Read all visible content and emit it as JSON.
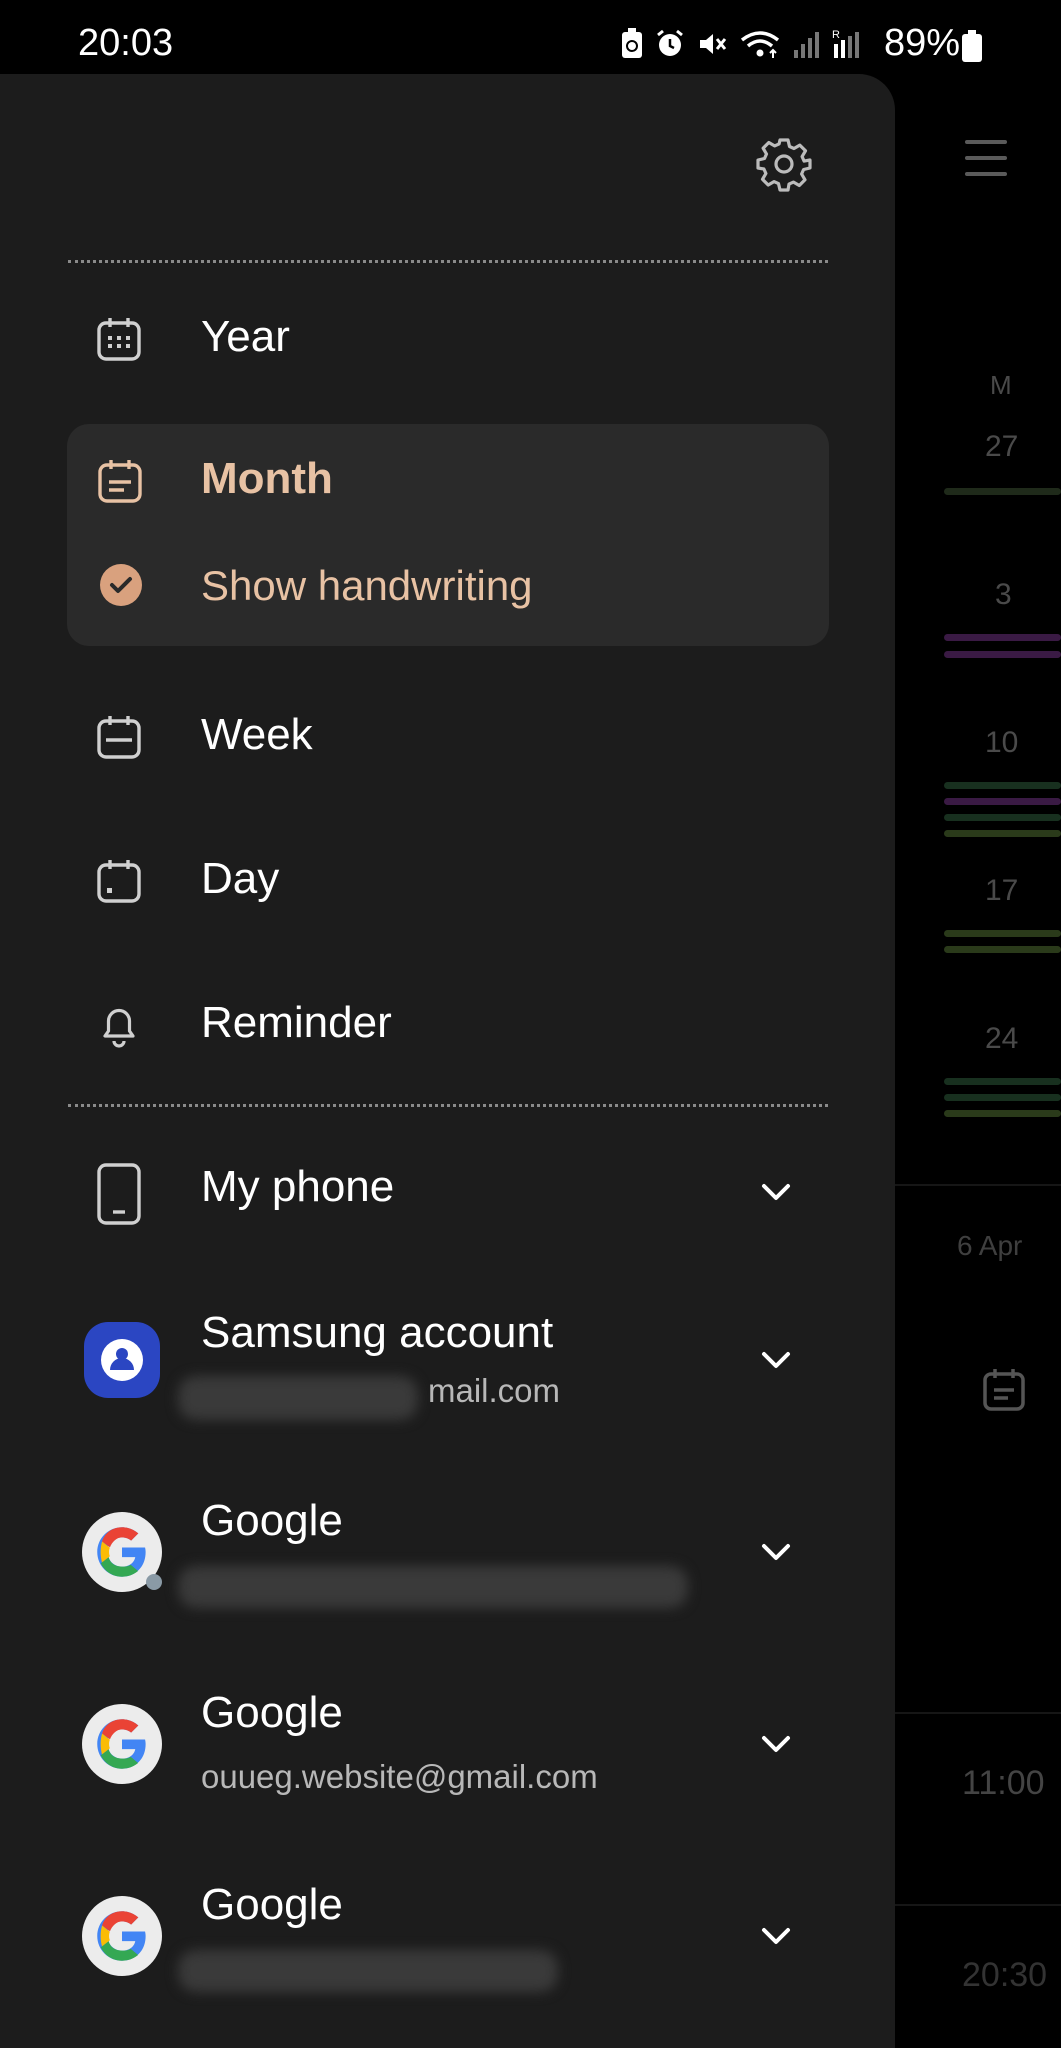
{
  "status_bar": {
    "time": "20:03",
    "battery": "89%"
  },
  "drawer": {
    "views": [
      {
        "label": "Year",
        "icon": "year-calendar-icon"
      },
      {
        "label": "Month",
        "icon": "month-calendar-icon",
        "selected": true
      },
      {
        "label": "Show handwriting",
        "icon": "check-circle-icon"
      },
      {
        "label": "Week",
        "icon": "week-calendar-icon"
      },
      {
        "label": "Day",
        "icon": "day-calendar-icon"
      },
      {
        "label": "Reminder",
        "icon": "bell-icon"
      }
    ],
    "accounts": [
      {
        "name": "My phone",
        "icon": "phone-icon",
        "email": ""
      },
      {
        "name": "Samsung account",
        "icon": "samsung-account-icon",
        "email": "mail.com"
      },
      {
        "name": "Google",
        "icon": "google-icon",
        "email": ""
      },
      {
        "name": "Google",
        "icon": "google-icon",
        "email": "ouueg.website@gmail.com"
      },
      {
        "name": "Google",
        "icon": "google-icon",
        "email": ""
      }
    ]
  },
  "background_calendar": {
    "day_header": "M",
    "dates": [
      "27",
      "3",
      "10",
      "17",
      "24"
    ],
    "date_label": "6 Apr",
    "times": [
      "11:00",
      "20:30"
    ]
  },
  "colors": {
    "accent": "#e8c2a4",
    "check": "#d9a17e",
    "drawer_bg": "#1c1c1c",
    "selected_bg": "#2a2a2a"
  }
}
